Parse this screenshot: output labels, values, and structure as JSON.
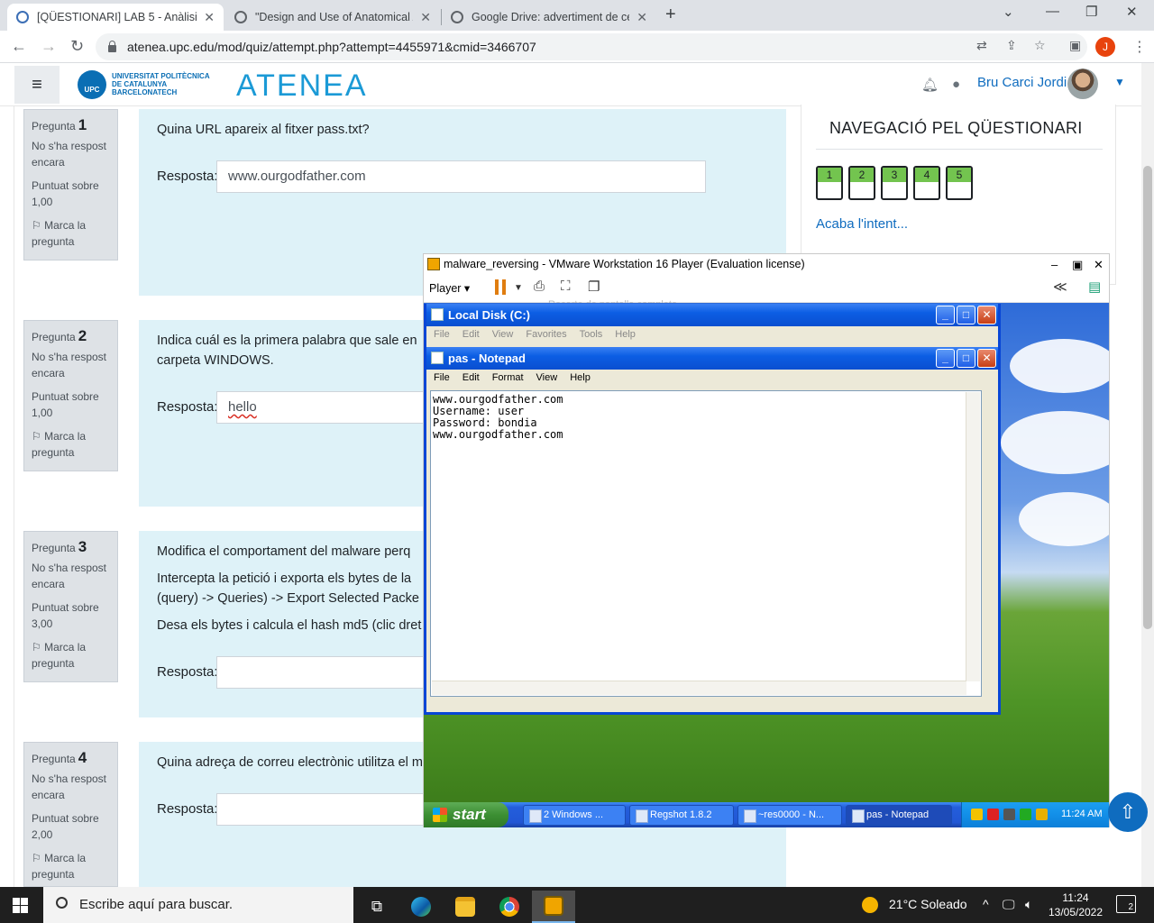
{
  "browser": {
    "tabs": [
      {
        "title": "[QÜESTIONARI] LAB 5 - Anàlisi d",
        "close": "✕"
      },
      {
        "title": "\"Design and Use of Anatomical A",
        "close": "✕"
      },
      {
        "title": "Google Drive: advertiment de ce",
        "close": "✕"
      }
    ],
    "url": "atenea.upc.edu/mod/quiz/attempt.php?attempt=4455971&cmid=3466707",
    "profile_initial": "J"
  },
  "header": {
    "logo_lines": [
      "UNIVERSITAT POLITÈCNICA",
      "DE CATALUNYA",
      "BARCELONATECH"
    ],
    "upc": "UPC",
    "site_name": "ATENEA",
    "user_name": "Bru Carci Jordi"
  },
  "questions": [
    {
      "label": "Pregunta",
      "number": "1",
      "state": "No s'ha respost encara",
      "grade": "Puntuat sobre 1,00",
      "flag": "Marca la pregunta",
      "text": "Quina URL apareix al fitxer pass.txt?",
      "answer_label": "Resposta:",
      "answer": "www.ourgodfather.com"
    },
    {
      "label": "Pregunta",
      "number": "2",
      "state": "No s'ha respost encara",
      "grade": "Puntuat sobre 1,00",
      "flag": "Marca la pregunta",
      "text_line1": "Indica cuál es la primera palabra que sale en",
      "text_line2": "carpeta WINDOWS.",
      "answer_label": "Resposta:",
      "answer": "hello"
    },
    {
      "label": "Pregunta",
      "number": "3",
      "state": "No s'ha respost encara",
      "grade": "Puntuat sobre 3,00",
      "flag": "Marca la pregunta",
      "text_line1": "Modifica el comportament del malware perq",
      "text_line2": "Intercepta la petició i exporta els bytes de la",
      "text_line3": "(query) -> Queries) -> Export Selected Packe",
      "text_line4": "Desa els bytes i calcula el hash md5 (clic dret",
      "answer_label": "Resposta:",
      "answer": ""
    },
    {
      "label": "Pregunta",
      "number": "4",
      "state": "No s'ha respost encara",
      "grade": "Puntuat sobre 2,00",
      "flag": "Marca la pregunta",
      "text": "Quina adreça de correu electrònic utilitza el m",
      "answer_label": "Resposta:",
      "answer": ""
    }
  ],
  "quiz_nav": {
    "title": "NAVEGACIÓ PEL QÜESTIONARI",
    "buttons": [
      "1",
      "2",
      "3",
      "4",
      "5"
    ],
    "finish": "Acaba l'intent..."
  },
  "vmware": {
    "title": "malware_reversing - VMware Workstation 16 Player (Evaluation license)",
    "player_menu": "Player",
    "tooltip": "Recorte de pantalla completa",
    "local_disk": {
      "title": "Local Disk (C:)",
      "menu": [
        "File",
        "Edit",
        "View",
        "Favorites",
        "Tools",
        "Help"
      ]
    },
    "notepad": {
      "title": "pas - Notepad",
      "menu": [
        "File",
        "Edit",
        "Format",
        "View",
        "Help"
      ],
      "content": "www.ourgodfather.com\nUsername: user\nPassword: bondia\nwww.ourgodfather.com"
    },
    "xp_taskbar": {
      "start": "start",
      "tasks": [
        "2 Windows ...",
        "Regshot 1.8.2",
        "~res0000 - N...",
        "pas - Notepad"
      ],
      "clock": "11:24 AM"
    }
  },
  "win10_taskbar": {
    "search_placeholder": "Escribe aquí para buscar.",
    "weather": "21°C  Soleado",
    "time": "11:24",
    "date": "13/05/2022",
    "notifications": "2"
  }
}
